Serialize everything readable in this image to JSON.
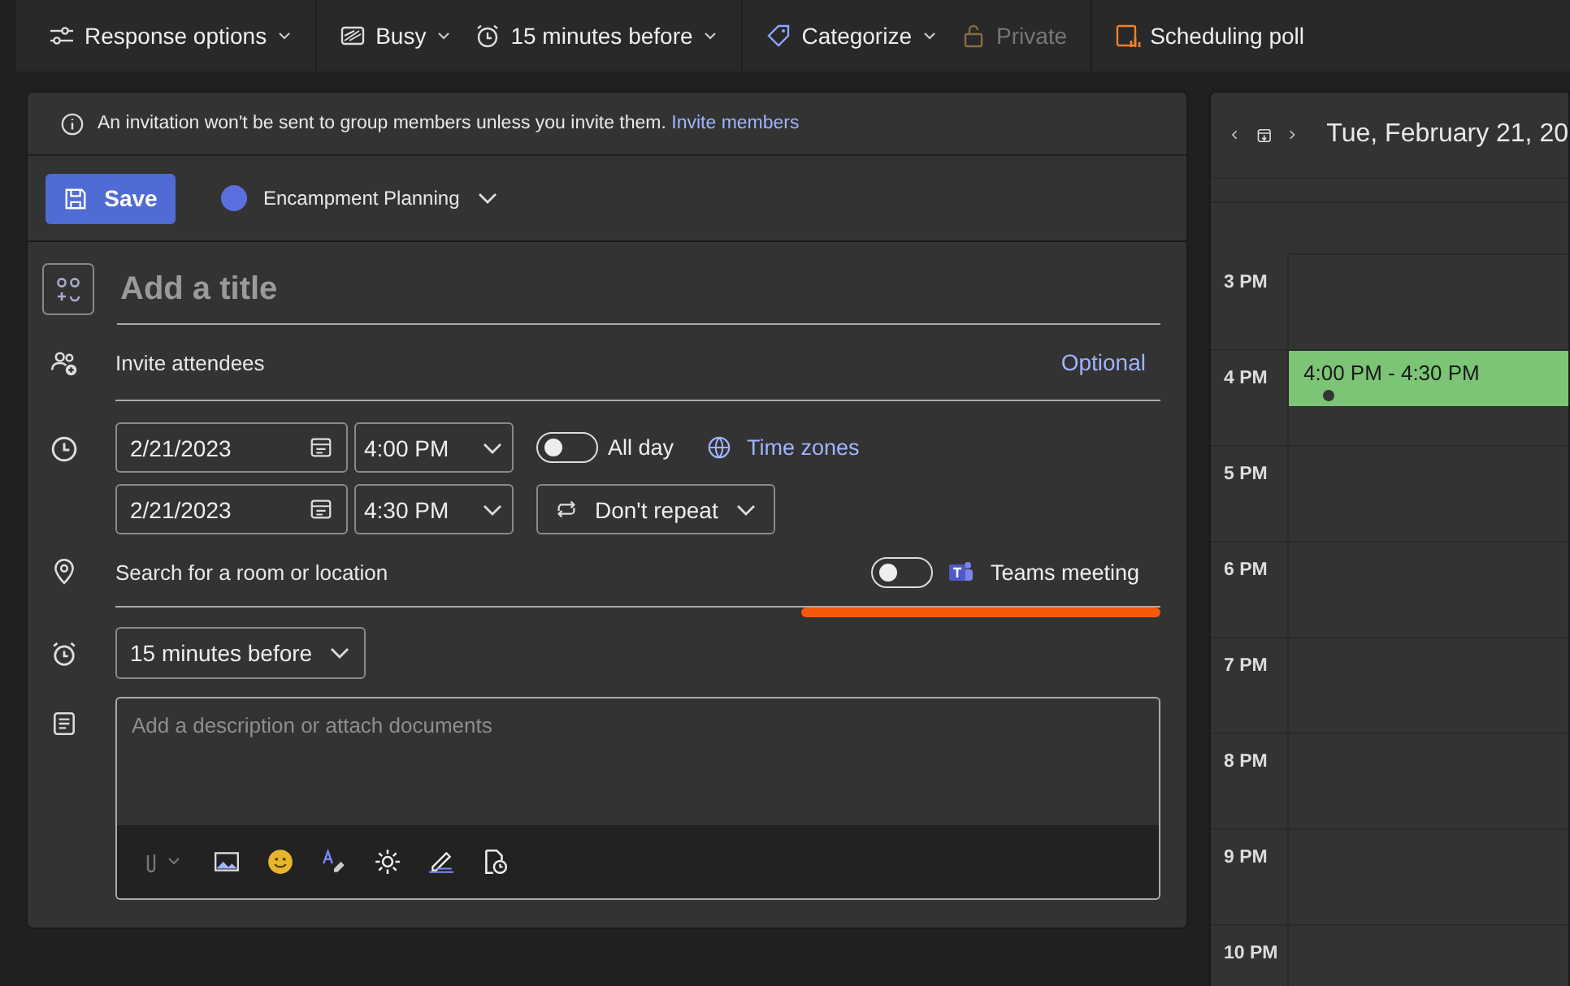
{
  "toolbar": [
    {
      "label": "Response options",
      "dropdown": true,
      "disabled": false
    },
    {
      "label": "Busy",
      "dropdown": true,
      "disabled": false
    },
    {
      "label": "15 minutes before",
      "dropdown": true,
      "disabled": false
    },
    {
      "label": "Categorize",
      "dropdown": true,
      "disabled": false
    },
    {
      "label": "Private",
      "dropdown": false,
      "disabled": true
    },
    {
      "label": "Scheduling poll",
      "dropdown": false,
      "disabled": false
    }
  ],
  "notice": {
    "text": "An invitation won't be sent to group members unless you invite them.",
    "link": "Invite members"
  },
  "save_button": "Save",
  "calendar_picker": "Encampment Planning",
  "title_field": {
    "placeholder": "Add a title"
  },
  "attendees": {
    "placeholder": "Invite attendees",
    "optional": "Optional"
  },
  "start": {
    "date": "2/21/2023",
    "time": "4:00 PM"
  },
  "end": {
    "date": "2/21/2023",
    "time": "4:30 PM"
  },
  "all_day": {
    "label": "All day",
    "on": false
  },
  "time_zones": "Time zones",
  "repeat": "Don't repeat",
  "location": {
    "placeholder": "Search for a room or location"
  },
  "teams_meeting": {
    "label": "Teams meeting",
    "on": false
  },
  "reminder": "15 minutes before",
  "description": {
    "placeholder": "Add a description or attach documents"
  },
  "day_view": {
    "date": "Tue, February 21, 20",
    "hours": [
      "3 PM",
      "4 PM",
      "5 PM",
      "6 PM",
      "7 PM",
      "8 PM",
      "9 PM",
      "10 PM"
    ],
    "event": {
      "time": "4:00 PM - 4:30 PM"
    }
  }
}
